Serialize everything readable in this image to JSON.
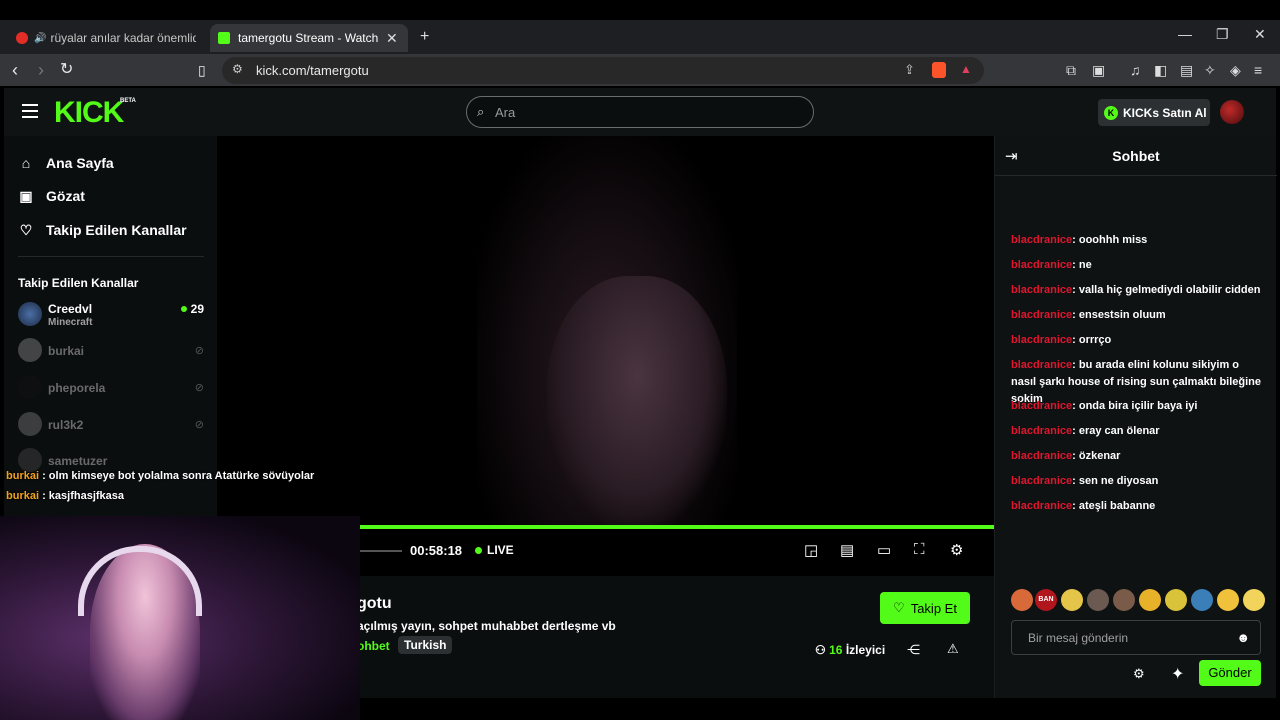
{
  "browser": {
    "tabs": [
      {
        "title": "rüyalar anılar kadar önemlidir | Yo",
        "active": false
      },
      {
        "title": "tamergotu Stream - Watch Live o",
        "active": true
      }
    ],
    "url": "kick.com/tamergotu",
    "new_tab": "+",
    "win_min": "—",
    "win_max": "❐",
    "win_close": "✕",
    "tab_close": "✕"
  },
  "header": {
    "logo": "KICK",
    "beta": "BETA",
    "search_placeholder": "Ara",
    "kicks_button": "KICKs Satın Al"
  },
  "sidebar": {
    "nav": [
      {
        "label": "Ana Sayfa",
        "icon": "home-icon"
      },
      {
        "label": "Gözat",
        "icon": "browse-icon"
      },
      {
        "label": "Takip Edilen Kanallar",
        "icon": "heart-icon"
      }
    ],
    "followed_title": "Takip Edilen Kanallar",
    "channels": [
      {
        "name": "Creedvl",
        "game": "Minecraft",
        "viewers": "29",
        "live": true
      },
      {
        "name": "burkai",
        "live": false
      },
      {
        "name": "pheporela",
        "live": false
      },
      {
        "name": "rul3k2",
        "live": false
      },
      {
        "name": "sametuzer",
        "live": false
      }
    ]
  },
  "player": {
    "time": "00:58:18",
    "live_label": "LIVE",
    "progress_fraction": 1.0
  },
  "stream": {
    "name_partial": "gotu",
    "title_partial": "açılmış yayın, sohpet muhabbet dertleşme vb",
    "category_partial": "ohbet",
    "tag": "Turkish",
    "follow_label": "Takip Et",
    "viewers_count": "16",
    "viewers_label": "İzleyici"
  },
  "chat": {
    "title": "Sohbet",
    "messages": [
      {
        "user": "blacdranice",
        "text": ": ooohhh miss"
      },
      {
        "user": "blacdranice",
        "text": ": ne"
      },
      {
        "user": "blacdranice",
        "text": ": valla hiç gelmediydi olabilir cidden"
      },
      {
        "user": "blacdranice",
        "text": ": ensestsin oluum"
      },
      {
        "user": "blacdranice",
        "text": ": orrrço"
      },
      {
        "user": "blacdranice",
        "text": ": bu arada elini kolunu sikiyim o nasıl şarkı house of rising sun çalmaktı bileğine sokim"
      },
      {
        "user": "blacdranice",
        "text": ": onda bira içilir baya iyi"
      },
      {
        "user": "blacdranice",
        "text": ": eray can ölenar"
      },
      {
        "user": "blacdranice",
        "text": ": özkenar"
      },
      {
        "user": "blacdranice",
        "text": ": sen ne diyosan"
      },
      {
        "user": "blacdranice",
        "text": ": ateşli babanne"
      }
    ],
    "input_placeholder": "Bir mesaj gönderin",
    "send_label": "Gönder"
  },
  "overlay": {
    "lines": [
      {
        "user": "burkai",
        "text": " : olm kimseye bot yolalma sonra Atatürke sövüyolar"
      },
      {
        "user": "burkai",
        "text": " : kasjfhasjfkasa"
      }
    ]
  },
  "colors": {
    "accent": "#53fc18",
    "chat_user": "#e0152e",
    "overlay_user": "#f2a21c"
  }
}
